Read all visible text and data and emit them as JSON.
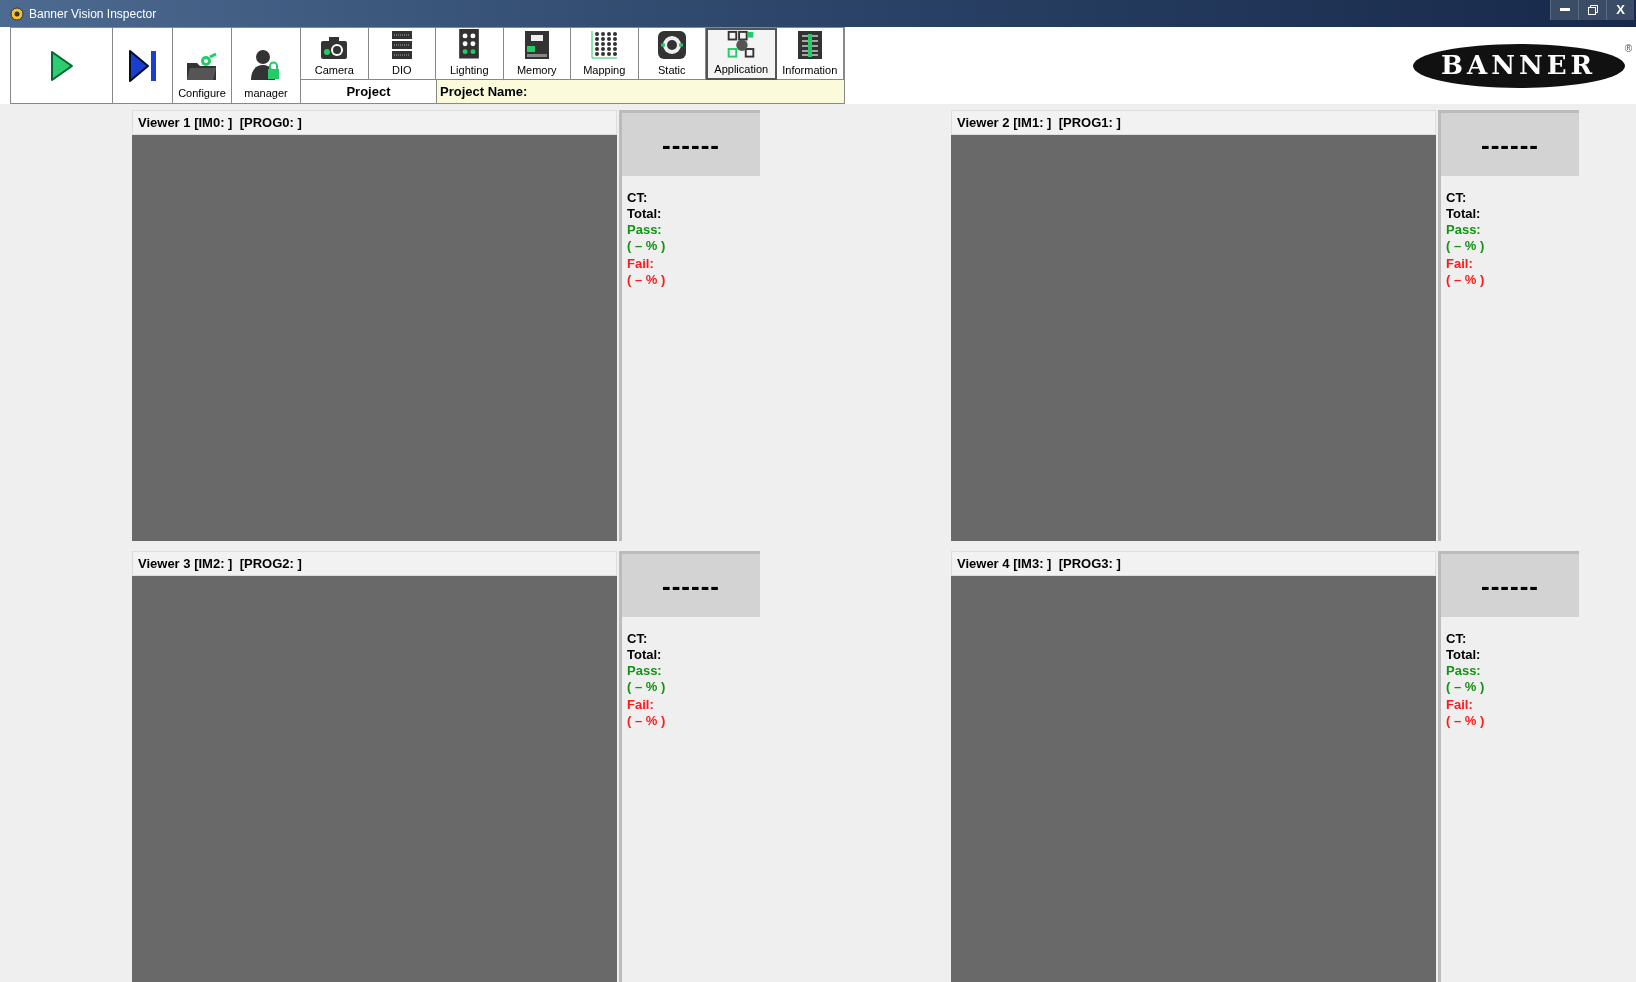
{
  "window": {
    "title": "Banner Vision Inspector",
    "controls": [
      {
        "kind": "minimize"
      },
      {
        "kind": "restore"
      },
      {
        "kind": "close",
        "label": "X"
      }
    ]
  },
  "toolbar": {
    "run_buttons": [
      {
        "kind": "play"
      },
      {
        "kind": "step"
      }
    ],
    "tools": [
      {
        "kind": "configure",
        "label": "Configure"
      },
      {
        "kind": "manager",
        "label": "manager"
      }
    ],
    "apps": [
      {
        "kind": "camera",
        "label": "Camera",
        "selected": false
      },
      {
        "kind": "dio",
        "label": "DIO",
        "selected": false
      },
      {
        "kind": "lighting",
        "label": "Lighting",
        "selected": false
      },
      {
        "kind": "memory",
        "label": "Memory",
        "selected": false
      },
      {
        "kind": "mapping",
        "label": "Mapping",
        "selected": false
      },
      {
        "kind": "static",
        "label": "Static",
        "selected": false
      },
      {
        "kind": "application",
        "label": "Application",
        "selected": true
      },
      {
        "kind": "information",
        "label": "Information",
        "selected": false
      }
    ],
    "project_label": "Project",
    "project_name_label": "Project Name:"
  },
  "logo": {
    "text": "BANNER",
    "mark": "®"
  },
  "viewers": [
    {
      "title": "Viewer 1 [IM0: ]  [PROG0: ]",
      "result": "------",
      "ct": "CT:",
      "total": "Total:",
      "pass": "Pass:",
      "pass_pct": "( – % )",
      "fail": "Fail:",
      "fail_pct": "( – % )"
    },
    {
      "title": "Viewer 2 [IM1: ]  [PROG1: ]",
      "result": "------",
      "ct": "CT:",
      "total": "Total:",
      "pass": "Pass:",
      "pass_pct": "( – % )",
      "fail": "Fail:",
      "fail_pct": "( – % )"
    },
    {
      "title": "Viewer 3 [IM2: ]  [PROG2: ]",
      "result": "------",
      "ct": "CT:",
      "total": "Total:",
      "pass": "Pass:",
      "pass_pct": "( – % )",
      "fail": "Fail:",
      "fail_pct": "( – % )"
    },
    {
      "title": "Viewer 4 [IM3: ]  [PROG3: ]",
      "result": "------",
      "ct": "CT:",
      "total": "Total:",
      "pass": "Pass:",
      "pass_pct": "( – % )",
      "fail": "Fail:",
      "fail_pct": "( – % )"
    }
  ]
}
